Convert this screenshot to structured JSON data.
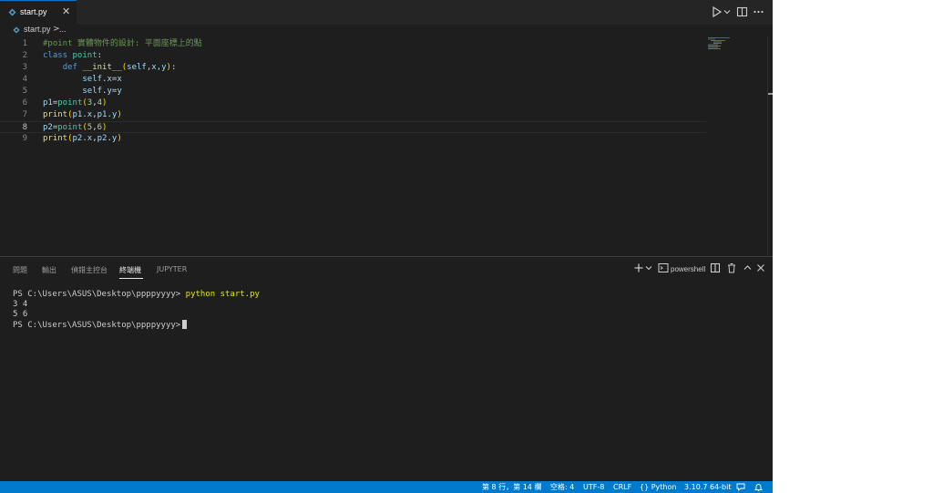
{
  "editor_tab": {
    "filename": "start.py"
  },
  "breadcrumb": {
    "file": "start.py",
    "separator": ">",
    "symbol": "..."
  },
  "code_lines": [
    {
      "line_number": "1",
      "tokens": [
        {
          "t": "cm",
          "v": "#point 實體物件的設計: 平面座標上的點"
        }
      ]
    },
    {
      "line_number": "2",
      "tokens": [
        {
          "t": "kw",
          "v": "class"
        },
        {
          "t": "pl",
          "v": " "
        },
        {
          "t": "cls",
          "v": "point"
        },
        {
          "t": "pl",
          "v": ":"
        }
      ]
    },
    {
      "line_number": "3",
      "tokens": [
        {
          "t": "pl",
          "v": "    "
        },
        {
          "t": "kw",
          "v": "def"
        },
        {
          "t": "pl",
          "v": " "
        },
        {
          "t": "fn",
          "v": "__init__"
        },
        {
          "t": "pn2",
          "v": "("
        },
        {
          "t": "vr",
          "v": "self"
        },
        {
          "t": "pl",
          "v": ","
        },
        {
          "t": "vr",
          "v": "x"
        },
        {
          "t": "pl",
          "v": ","
        },
        {
          "t": "vr",
          "v": "y"
        },
        {
          "t": "pn2",
          "v": ")"
        },
        {
          "t": "pl",
          "v": ":"
        }
      ]
    },
    {
      "line_number": "4",
      "tokens": [
        {
          "t": "pl",
          "v": "        "
        },
        {
          "t": "vr",
          "v": "self"
        },
        {
          "t": "pl",
          "v": "."
        },
        {
          "t": "vr",
          "v": "x"
        },
        {
          "t": "pl",
          "v": "="
        },
        {
          "t": "vr",
          "v": "x"
        }
      ]
    },
    {
      "line_number": "5",
      "tokens": [
        {
          "t": "pl",
          "v": "        "
        },
        {
          "t": "vr",
          "v": "self"
        },
        {
          "t": "pl",
          "v": "."
        },
        {
          "t": "vr",
          "v": "y"
        },
        {
          "t": "pl",
          "v": "="
        },
        {
          "t": "vr",
          "v": "y"
        }
      ]
    },
    {
      "line_number": "6",
      "tokens": [
        {
          "t": "vr",
          "v": "p1"
        },
        {
          "t": "pl",
          "v": "="
        },
        {
          "t": "cls",
          "v": "point"
        },
        {
          "t": "pn2",
          "v": "("
        },
        {
          "t": "nm",
          "v": "3"
        },
        {
          "t": "pl",
          "v": ","
        },
        {
          "t": "nm",
          "v": "4"
        },
        {
          "t": "pn2",
          "v": ")"
        }
      ]
    },
    {
      "line_number": "7",
      "tokens": [
        {
          "t": "fn",
          "v": "print"
        },
        {
          "t": "pn2",
          "v": "("
        },
        {
          "t": "vr",
          "v": "p1"
        },
        {
          "t": "pl",
          "v": "."
        },
        {
          "t": "vr",
          "v": "x"
        },
        {
          "t": "pl",
          "v": ","
        },
        {
          "t": "vr",
          "v": "p1"
        },
        {
          "t": "pl",
          "v": "."
        },
        {
          "t": "vr",
          "v": "y"
        },
        {
          "t": "pn2",
          "v": ")"
        }
      ]
    },
    {
      "line_number": "8",
      "tokens": [
        {
          "t": "vr",
          "v": "p2"
        },
        {
          "t": "pl",
          "v": "="
        },
        {
          "t": "cls",
          "v": "point"
        },
        {
          "t": "pn2",
          "v": "("
        },
        {
          "t": "nm",
          "v": "5"
        },
        {
          "t": "pl",
          "v": ","
        },
        {
          "t": "nm",
          "v": "6"
        },
        {
          "t": "pn2",
          "v": ")"
        }
      ]
    },
    {
      "line_number": "9",
      "tokens": [
        {
          "t": "fn",
          "v": "print"
        },
        {
          "t": "pn2",
          "v": "("
        },
        {
          "t": "vr",
          "v": "p2"
        },
        {
          "t": "pl",
          "v": "."
        },
        {
          "t": "vr",
          "v": "x"
        },
        {
          "t": "pl",
          "v": ","
        },
        {
          "t": "vr",
          "v": "p2"
        },
        {
          "t": "pl",
          "v": "."
        },
        {
          "t": "vr",
          "v": "y"
        },
        {
          "t": "pn2",
          "v": ")"
        }
      ]
    }
  ],
  "current_line": "8",
  "panel": {
    "tabs": [
      "問題",
      "輸出",
      "偵錯主控台",
      "終端機",
      "JUPYTER"
    ],
    "active_tab": "終端機",
    "shell_label": "powershell"
  },
  "terminal": {
    "prompt": "PS C:\\Users\\ASUS\\Desktop\\ppppyyyy>",
    "command": "python start.py",
    "output": [
      "3 4",
      "5 6"
    ]
  },
  "status_bar": {
    "cursor_position": "第 8 行，第 14 欄",
    "indent": "空格: 4",
    "encoding": "UTF-8",
    "eol": "CRLF",
    "language": "Python",
    "interpreter": "3.10.7 64-bit"
  },
  "icons": {
    "tab_file": "python-file-icon",
    "tab_close": "close-icon",
    "run": "play-icon",
    "run_menu": "chevron-down-icon",
    "split": "split-editor-icon",
    "more": "ellipsis-icon",
    "new_terminal": "plus-icon",
    "terminal_menu": "chevron-down-icon",
    "terminal_shell": "terminal-icon",
    "split_terminal": "split-terminal-icon",
    "kill_terminal": "trash-icon",
    "maximize_panel": "chevron-up-icon",
    "close_panel": "close-icon",
    "language": "braces-icon",
    "feedback": "feedback-icon",
    "notifications": "bell-icon"
  },
  "colors": {
    "accent": "#007acc",
    "editor_bg": "#1e1e1e",
    "tab_bar_bg": "#252526",
    "python_icon": "#519aba"
  }
}
